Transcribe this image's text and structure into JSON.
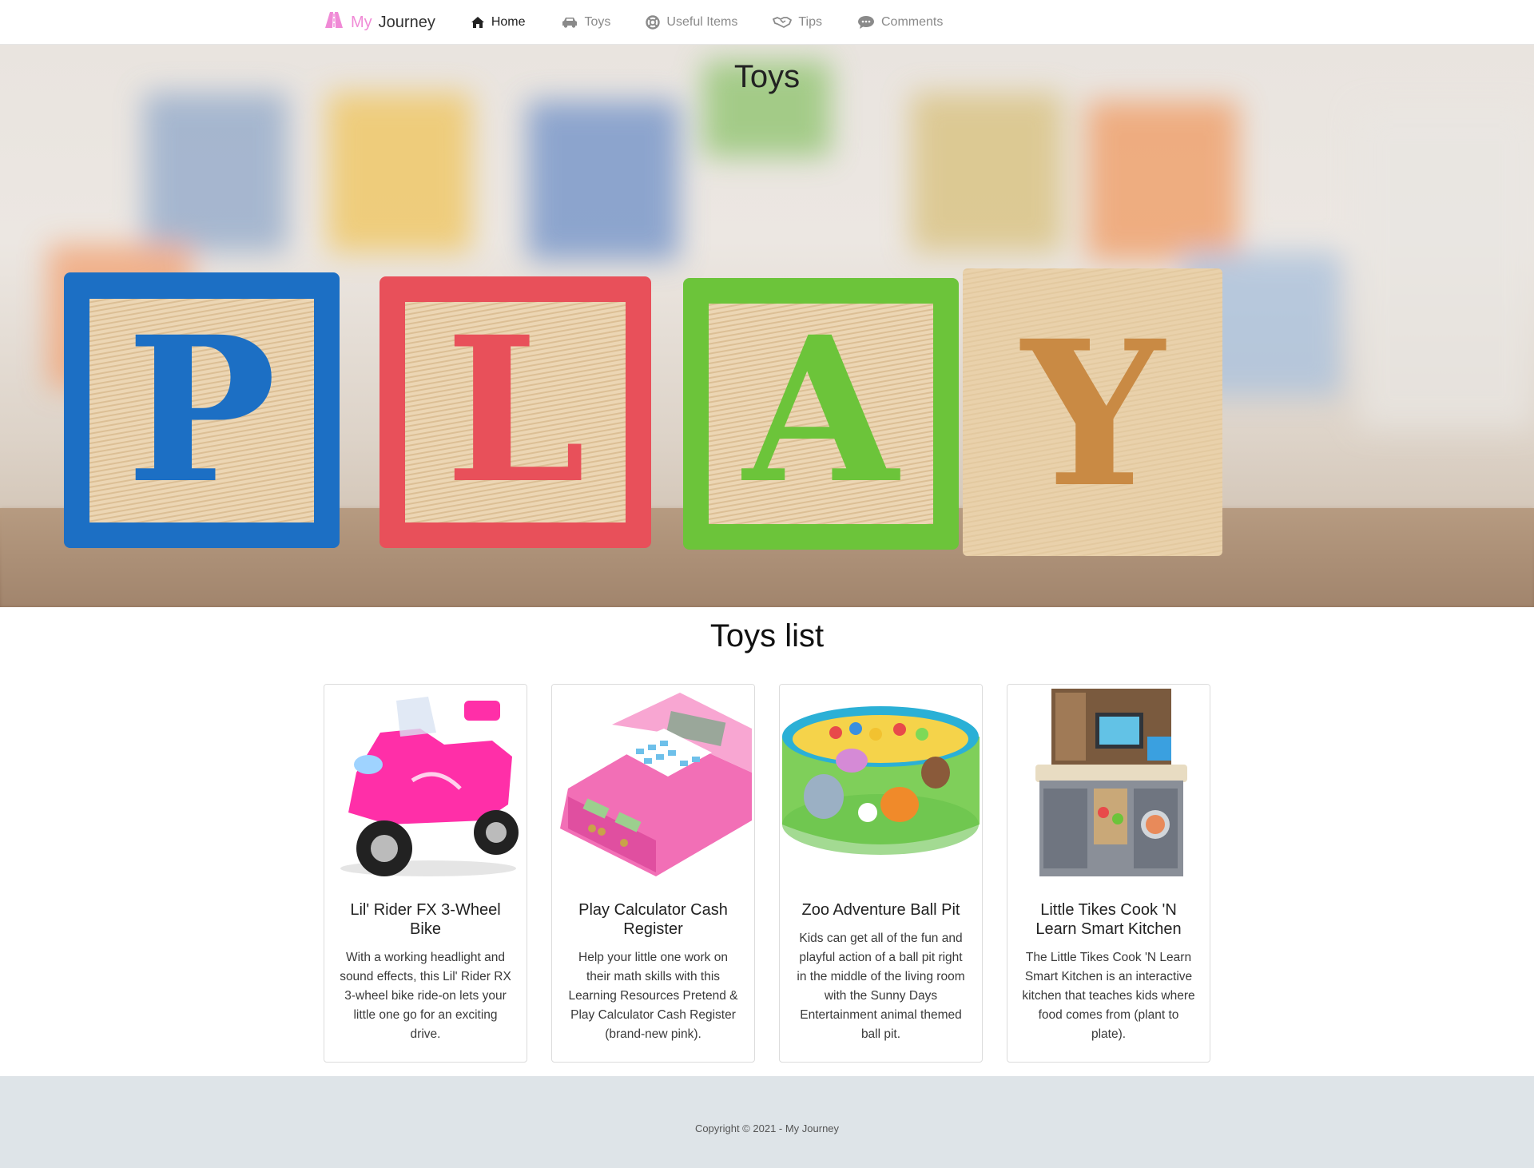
{
  "navbar": {
    "brand_my": "My",
    "brand_journey": "Journey",
    "links": [
      {
        "label": "Home",
        "icon": "home-icon",
        "active": true
      },
      {
        "label": "Toys",
        "icon": "car-icon"
      },
      {
        "label": "Useful Items",
        "icon": "life-ring-icon"
      },
      {
        "label": "Tips",
        "icon": "handshake-icon"
      },
      {
        "label": "Comments",
        "icon": "comments-icon"
      }
    ]
  },
  "hero": {
    "title": "Toys",
    "blocks": [
      "P",
      "L",
      "A",
      "Y"
    ]
  },
  "section": {
    "title": "Toys list"
  },
  "cards": [
    {
      "title": "Lil' Rider FX 3-Wheel Bike",
      "text": "With a working headlight and sound effects, this Lil' Rider RX 3-wheel bike ride-on lets your little one go for an exciting drive."
    },
    {
      "title": "Play Calculator Cash Register",
      "text": "Help your little one work on their math skills with this Learning Resources Pretend & Play Calculator Cash Register (brand-new pink)."
    },
    {
      "title": "Zoo Adventure Ball Pit",
      "text": "Kids can get all of the fun and playful action of a ball pit right in the middle of the living room with the Sunny Days Entertainment animal themed ball pit."
    },
    {
      "title": "Little Tikes Cook 'N Learn Smart Kitchen",
      "text": "The Little Tikes Cook 'N Learn Smart Kitchen is an interactive kitchen that teaches kids where food comes from (plant to plate)."
    }
  ],
  "footer": {
    "text": "Copyright © 2021 - My Journey"
  },
  "colors": {
    "brand_pink": "#f08ad6",
    "footer_bg": "#dee4e8",
    "block_blue": "#1c6fc4",
    "block_red": "#e8505a",
    "block_green": "#6cc43a",
    "block_wood": "#e7cfa6"
  }
}
